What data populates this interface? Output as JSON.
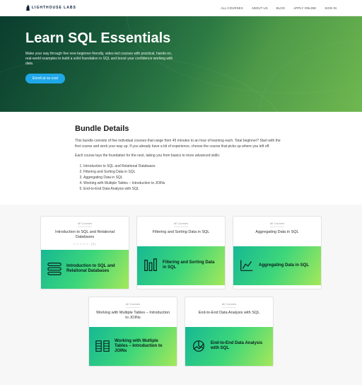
{
  "brand": "LIGHTHOUSE LABS",
  "nav": {
    "items": [
      "ALL COURSES",
      "ABOUT US",
      "BLOG",
      "APPLY ONLINE",
      "SIGN IN"
    ]
  },
  "hero": {
    "title": "Learn SQL Essentials",
    "subtitle": "Make your way through five new beginner-friendly, video-led courses with practical, hands-on, real-world examples to build a solid foundation in SQL and boost your confidence working with data.",
    "cta": "Enroll at no cost"
  },
  "details": {
    "heading": "Bundle Details",
    "p1": "This bundle consists of five individual courses that range from 45 minutes to an hour of learning each. Total beginner? Start with the first course and work your way up. If you already have a bit of experience, choose the course that picks up where you left off.",
    "p2": "Each course lays the foundation for the next, taking you from basics to more advanced skills:",
    "list": [
      "Introduction to SQL and Relational Databases",
      "Filtering and Sorting Data in SQL",
      "Aggregating Data in SQL",
      "Working with Multiple Tables – Introduction to JOINs",
      "End-to-End Data Analysis with SQL"
    ]
  },
  "courses": {
    "category": "All Courses",
    "stars": "☆☆☆☆☆ (0)",
    "items": [
      {
        "title": "Introduction to SQL and Relational Databases",
        "thumb": "Introduction to SQL and Relational Databases",
        "icon": "db",
        "stars": true
      },
      {
        "title": "Filtering and Sorting Data in SQL",
        "thumb": "Filtering and Sorting Data in SQL",
        "icon": "filter"
      },
      {
        "title": "Aggregating Data in SQL",
        "thumb": "Aggregating Data in SQL",
        "icon": "chart"
      },
      {
        "title": "Working with Multiple Tables – Introduction to JOINs",
        "thumb": "Working with Multiple Tables – Introduction to JOINs",
        "icon": "tables"
      },
      {
        "title": "End-to-End Data Analysis with SQL",
        "thumb": "End-to-End Data Analysis with SQL",
        "icon": "pie"
      }
    ]
  }
}
